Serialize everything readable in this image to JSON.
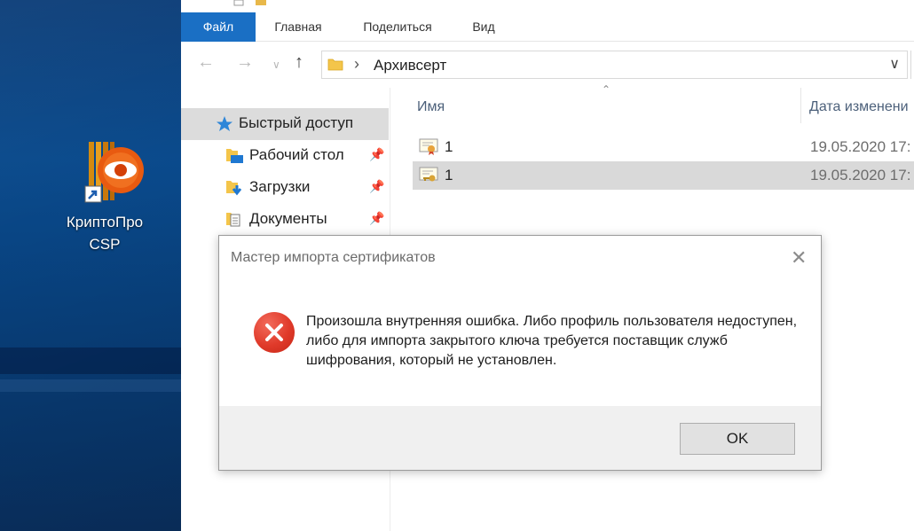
{
  "desktop": {
    "icon_label": "КриптоПро\nCSP"
  },
  "ribbon": {
    "tabs": [
      {
        "label": "Файл",
        "active": true
      },
      {
        "label": "Главная",
        "active": false
      },
      {
        "label": "Поделиться",
        "active": false
      },
      {
        "label": "Вид",
        "active": false
      }
    ]
  },
  "address": {
    "path": "Архивсерт"
  },
  "navpane": {
    "items": [
      {
        "label": "Быстрый доступ",
        "selected": true,
        "pinned": false
      },
      {
        "label": "Рабочий стол",
        "selected": false,
        "pinned": true
      },
      {
        "label": "Загрузки",
        "selected": false,
        "pinned": true
      },
      {
        "label": "Документы",
        "selected": false,
        "pinned": true
      }
    ]
  },
  "filelist": {
    "columns": [
      "Имя",
      "Дата изменени"
    ],
    "rows": [
      {
        "name": "1",
        "date": "19.05.2020 17:",
        "selected": false
      },
      {
        "name": "1",
        "date": "19.05.2020 17:",
        "selected": true
      }
    ]
  },
  "dialog": {
    "title": "Мастер импорта сертификатов",
    "message": "Произошла внутренняя ошибка. Либо профиль пользователя недоступен, либо для импорта закрытого ключа требуется поставщик служб шифрования, который не установлен.",
    "ok_label": "OK"
  },
  "colors": {
    "accent": "#1a6fc4",
    "error": "#e03a2a",
    "desktop": "#0a4a8c"
  }
}
